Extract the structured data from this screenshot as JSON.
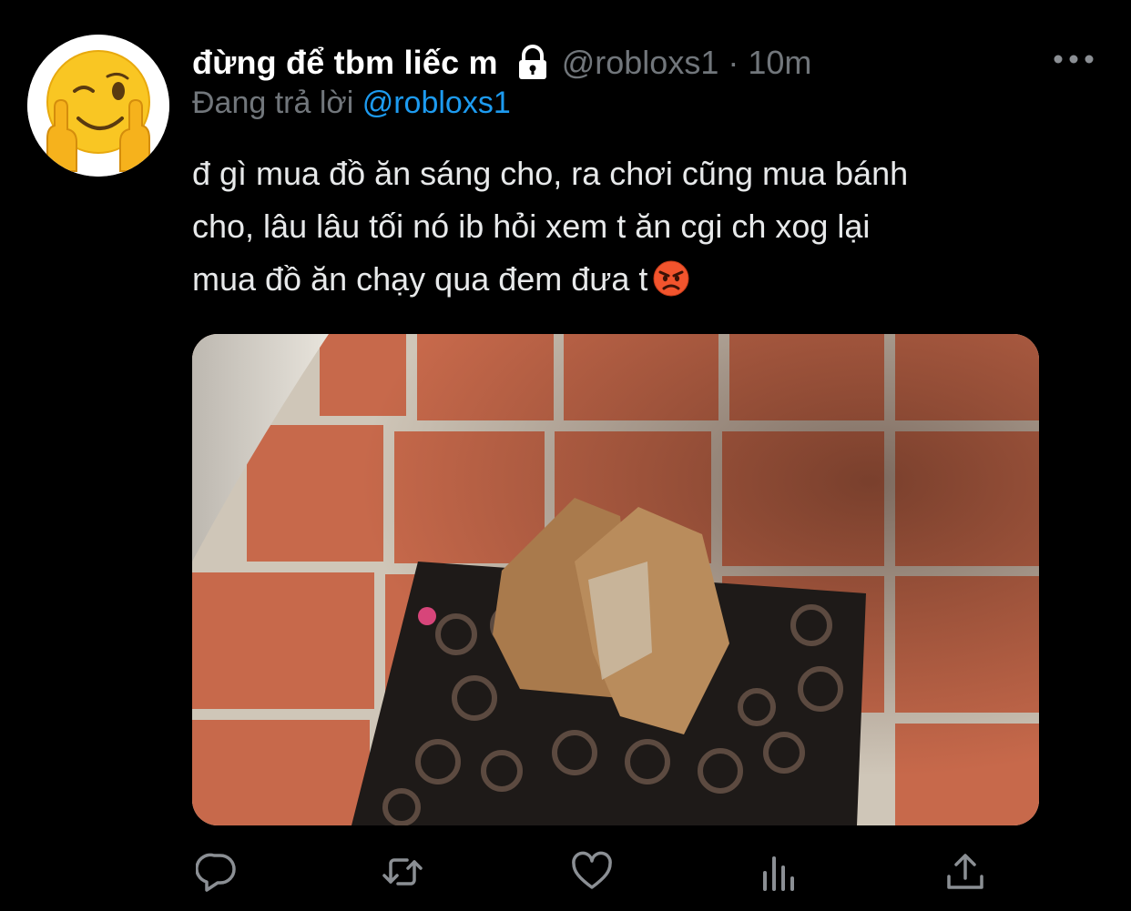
{
  "tweet": {
    "display_name": "đừng để tbm liếc m",
    "handle": "@robloxs1",
    "separator": "·",
    "timestamp": "10m",
    "reply_prefix": "Đang trả lời",
    "reply_to": "@robloxs1",
    "text_lines": [
      "đ gì mua đồ ăn sáng cho, ra chơi cũng mua bánh",
      "cho, lâu lâu tối nó ib hỏi xem t ăn cgi ch xog lại",
      "mua đồ ăn chạy qua đem đưa t"
    ]
  },
  "icons": {
    "avatar": "winking-face-with-middle-fingers-emoji",
    "protected": "lock-icon",
    "more": "more-dots-icon",
    "inline_emoji": "angry-face-emoji",
    "actions": [
      "reply-icon",
      "retweet-icon",
      "like-icon",
      "analytics-icon",
      "share-icon"
    ]
  },
  "colors": {
    "background": "#000000",
    "text": "#e7e9ea",
    "muted": "#71767b",
    "mention": "#1d9bf0"
  }
}
